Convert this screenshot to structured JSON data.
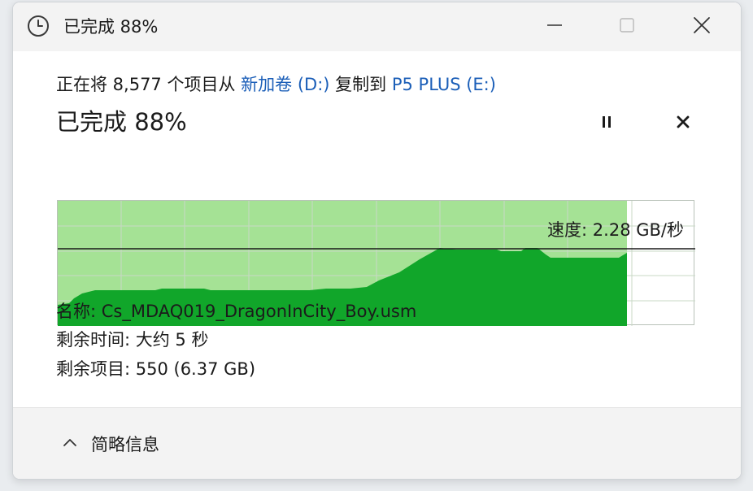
{
  "window": {
    "title": "已完成 88%"
  },
  "copy": {
    "prefix": "正在将 8,577 个项目从 ",
    "source": "新加卷 (D:)",
    "middle": " 复制到 ",
    "destination": "P5 PLUS (E:)",
    "percent_text": "已完成 88%",
    "progress_fraction": 0.88
  },
  "graph": {
    "speed_label": "速度: 2.28 GB/秒",
    "fill_color": "#a5e295",
    "area_color": "#11a62a",
    "line_color": "#1a1a1a"
  },
  "details": {
    "name": "名称: Cs_MDAQ019_DragonInCity_Boy.usm",
    "time_remaining": "剩余时间: 大约 5 秒",
    "items_remaining": "剩余项目: 550 (6.37 GB)"
  },
  "footer": {
    "less_details_label": "简略信息",
    "less_details_icon": "chevron-up-icon"
  },
  "icons": {
    "app": "clock-icon",
    "minimize": "minimize-icon",
    "maximize": "maximize-icon",
    "close": "close-icon",
    "pause": "pause-icon",
    "cancel": "cancel-icon"
  }
}
